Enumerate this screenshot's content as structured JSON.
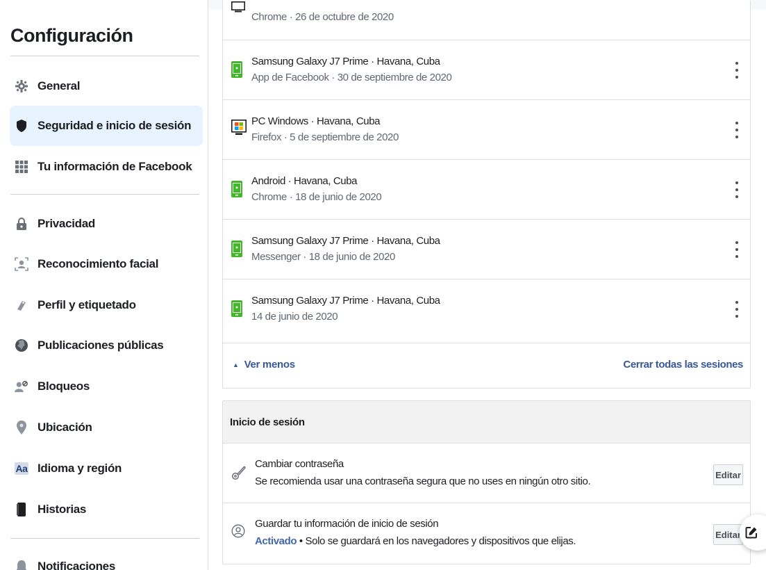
{
  "sidebar": {
    "title": "Configuración",
    "items": [
      {
        "label": "General",
        "icon": "gear-icon"
      },
      {
        "label": "Seguridad e inicio de sesión",
        "icon": "shield-icon",
        "active": true
      },
      {
        "label": "Tu información de Facebook",
        "icon": "grid-icon"
      },
      {
        "label": "Privacidad",
        "icon": "lock-icon"
      },
      {
        "label": "Reconocimiento facial",
        "icon": "face-icon"
      },
      {
        "label": "Perfil y etiquetado",
        "icon": "tag-icon"
      },
      {
        "label": "Publicaciones públicas",
        "icon": "globe-icon"
      },
      {
        "label": "Bloqueos",
        "icon": "block-user-icon"
      },
      {
        "label": "Ubicación",
        "icon": "location-pin-icon"
      },
      {
        "label": "Idioma y región",
        "icon": "language-icon"
      },
      {
        "label": "Historias",
        "icon": "book-icon"
      },
      {
        "label": "Notificaciones",
        "icon": "bell-icon"
      }
    ],
    "language_icon_text": "Aa"
  },
  "sessions": {
    "rows": [
      {
        "line1": "",
        "line2": "Chrome · 26 de octubre de 2020",
        "icon": "monitor-icon"
      },
      {
        "line1": "Samsung Galaxy J7 Prime · Havana, Cuba",
        "line2": "App de Facebook · 30 de septiembre de 2020",
        "icon": "phone-icon"
      },
      {
        "line1": "PC Windows · Havana, Cuba",
        "line2": "Firefox · 5 de septiembre de 2020",
        "icon": "windows-pc-icon"
      },
      {
        "line1": "Android · Havana, Cuba",
        "line2": "Chrome · 18 de junio de 2020",
        "icon": "phone-icon"
      },
      {
        "line1": "Samsung Galaxy J7 Prime · Havana, Cuba",
        "line2": "Messenger · 18 de junio de 2020",
        "icon": "phone-icon"
      },
      {
        "line1": "Samsung Galaxy J7 Prime · Havana, Cuba",
        "line2": "14 de junio de 2020",
        "icon": "phone-icon"
      }
    ],
    "see_less": "Ver menos",
    "close_all": "Cerrar todas las sesiones"
  },
  "login": {
    "header": "Inicio de sesión",
    "change_password": {
      "title": "Cambiar contraseña",
      "desc": "Se recomienda usar una contraseña segura que no uses en ningún otro sitio.",
      "button": "Editar"
    },
    "save_login": {
      "title": "Guardar tu información de inicio de sesión",
      "status": "Activado",
      "desc": " • Solo se guardará en los navegadores y dispositivos que elijas.",
      "button": "Editar"
    }
  },
  "colors": {
    "link": "#385898",
    "active_bg": "#e7f3ff",
    "phone_green": "#42b72a"
  }
}
